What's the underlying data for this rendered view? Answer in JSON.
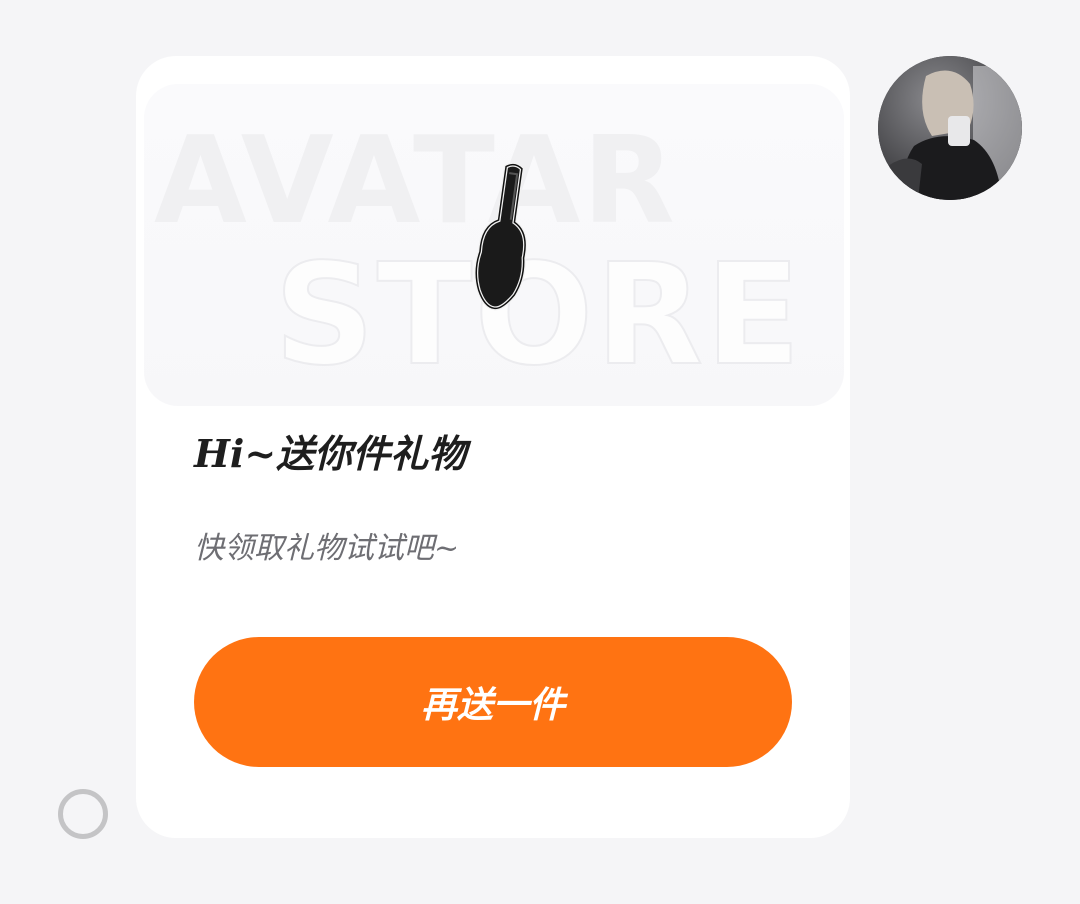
{
  "banner": {
    "watermark_line1": "AVATAR",
    "watermark_line2": "STORE",
    "gift_icon": "guitar-case-icon"
  },
  "message": {
    "title": "Hi~送你件礼物",
    "subtitle": "快领取礼物试试吧~"
  },
  "actions": {
    "send_again_label": "再送一件"
  },
  "colors": {
    "accent": "#ff7312",
    "card_bg": "#ffffff",
    "page_bg": "#f5f5f7",
    "title_text": "#1e1e1e",
    "subtitle_text": "#6e6e73"
  },
  "sender": {
    "avatar_icon": "user-avatar-photo"
  },
  "status": {
    "icon": "send-status-circle-icon"
  }
}
